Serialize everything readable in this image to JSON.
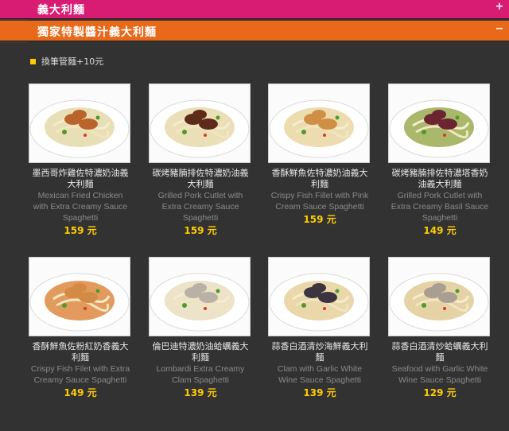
{
  "menu": {
    "category_pasta": {
      "label": "義大利麵",
      "icon": "plus-icon"
    },
    "category_special": {
      "label": "獨家特製醬汁義大利麵",
      "icon": "minus-icon"
    }
  },
  "note": "換筆管麵+10元",
  "currency": "元",
  "items": [
    {
      "zh": "墨西哥炸雞佐特濃奶油義大利麵",
      "en": "Mexican Fried Chicken with Extra Creamy Sauce Spaghetti",
      "price": "159 元",
      "sauce": "#e9dfb7",
      "topping": "#b8642a"
    },
    {
      "zh": "碳烤豬腩排佐特濃奶油義大利麵",
      "en": "Grilled Pork Cutlet with Extra Creamy Sauce Spaghetti",
      "price": "159 元",
      "sauce": "#eadfb6",
      "topping": "#5e2b1b"
    },
    {
      "zh": "香酥鮮魚佐特濃奶油義大利麵",
      "en": "Crispy Fish Fillet with Pink Cream Sauce Spaghetti",
      "price": "159 元",
      "sauce": "#ecdcb0",
      "topping": "#cf8f45"
    },
    {
      "zh": "碳烤豬腩排佐特濃塔香奶油義大利麵",
      "en": "Grilled Pork Cutlet with Extra Creamy Basil Sauce Spaghetti",
      "price": "149 元",
      "sauce": "#a9b86b",
      "topping": "#6b2430"
    },
    {
      "zh": "香酥鮮魚佐粉紅奶香義大利麵",
      "en": "Crispy Fish Filet with Extra Creamy Sauce Spaghetti",
      "price": "149 元",
      "sauce": "#e39a5d",
      "topping": "#d28a44"
    },
    {
      "zh": "倫巴迪特濃奶油蛤蠣義大利麵",
      "en": "Lombardi Extra Creamy Clam Spaghetti",
      "price": "139 元",
      "sauce": "#ece3c8",
      "topping": "#b9b1a5"
    },
    {
      "zh": "蒜香白酒清炒海鮮義大利麵",
      "en": "Clam with Garlic White Wine Sauce Spaghetti",
      "price": "139 元",
      "sauce": "#ead7aa",
      "topping": "#3c3540"
    },
    {
      "zh": "蒜香白酒清炒蛤蠣義大利麵",
      "en": "Seafood with Garlic White Wine Sauce Spaghetti",
      "price": "129 元",
      "sauce": "#e5d3a6",
      "topping": "#a89e92"
    }
  ]
}
